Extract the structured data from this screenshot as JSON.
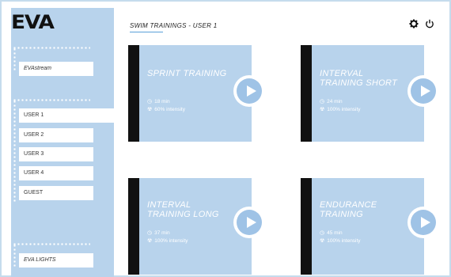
{
  "app": {
    "logo": "EVA"
  },
  "header": {
    "title": "SWIM TRAININGS - USER 1"
  },
  "sidebar": {
    "stream_label": "EVAstream",
    "users": [
      "USER 1",
      "USER 2",
      "USER 3",
      "USER 4",
      "GUEST"
    ],
    "active_user": "USER 1",
    "lights_label": "EVA LIGHTS"
  },
  "cards": [
    {
      "title_line1": "SPRINT TRAINING",
      "title_line2": "",
      "duration": "18 min",
      "intensity": "60% intensity"
    },
    {
      "title_line1": "INTERVAL",
      "title_line2": "TRAINING SHORT",
      "duration": "24 min",
      "intensity": "100% intensity"
    },
    {
      "title_line1": "INTERVAL",
      "title_line2": "TRAINING LONG",
      "duration": "37 min",
      "intensity": "100% intensity"
    },
    {
      "title_line1": "ENDURANCE",
      "title_line2": "TRAINING",
      "duration": "45 min",
      "intensity": "100% intensity"
    }
  ],
  "icons": {
    "settings": "gear-icon",
    "power": "power-icon",
    "play": "play-icon",
    "clock": "clock-icon",
    "intensity": "intensity-icon"
  },
  "colors": {
    "panel": "#b8d3ec",
    "accent": "#5aa0d8",
    "bar": "#111111"
  }
}
